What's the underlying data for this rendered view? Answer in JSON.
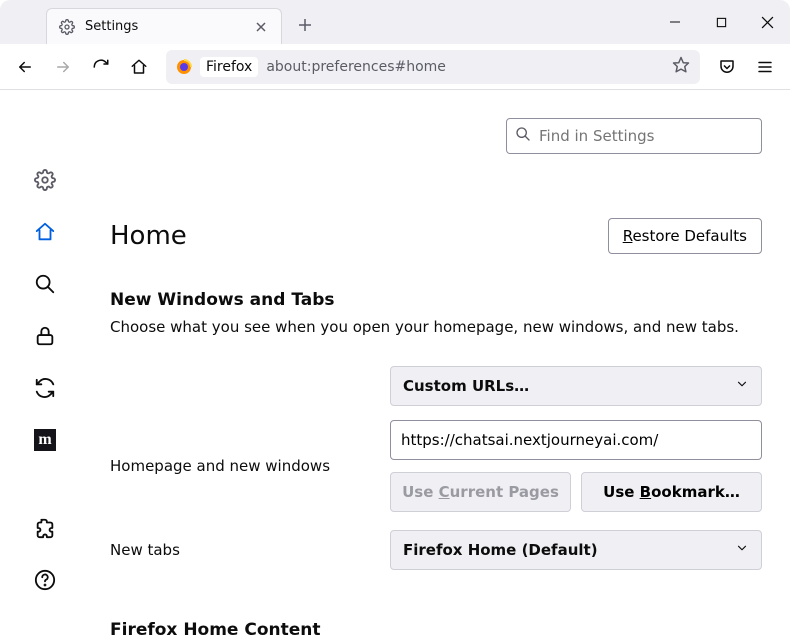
{
  "titlebar": {
    "tab_label": "Settings"
  },
  "urlbar": {
    "identity": "Firefox",
    "path": "about:preferences#home"
  },
  "search": {
    "placeholder": "Find in Settings"
  },
  "page": {
    "heading": "Home",
    "restore": "Restore Defaults",
    "section_title": "New Windows and Tabs",
    "section_desc": "Choose what you see when you open your homepage, new windows, and new tabs.",
    "homepage_label": "Homepage and new windows",
    "homepage_select": "Custom URLs…",
    "homepage_url": "https://chatsai.nextjourneyai.com/",
    "use_current": "Use Current Pages",
    "use_bookmark": "Use Bookmark…",
    "newtabs_label": "New tabs",
    "newtabs_select": "Firefox Home (Default)",
    "sub_section": "Firefox Home Content"
  }
}
